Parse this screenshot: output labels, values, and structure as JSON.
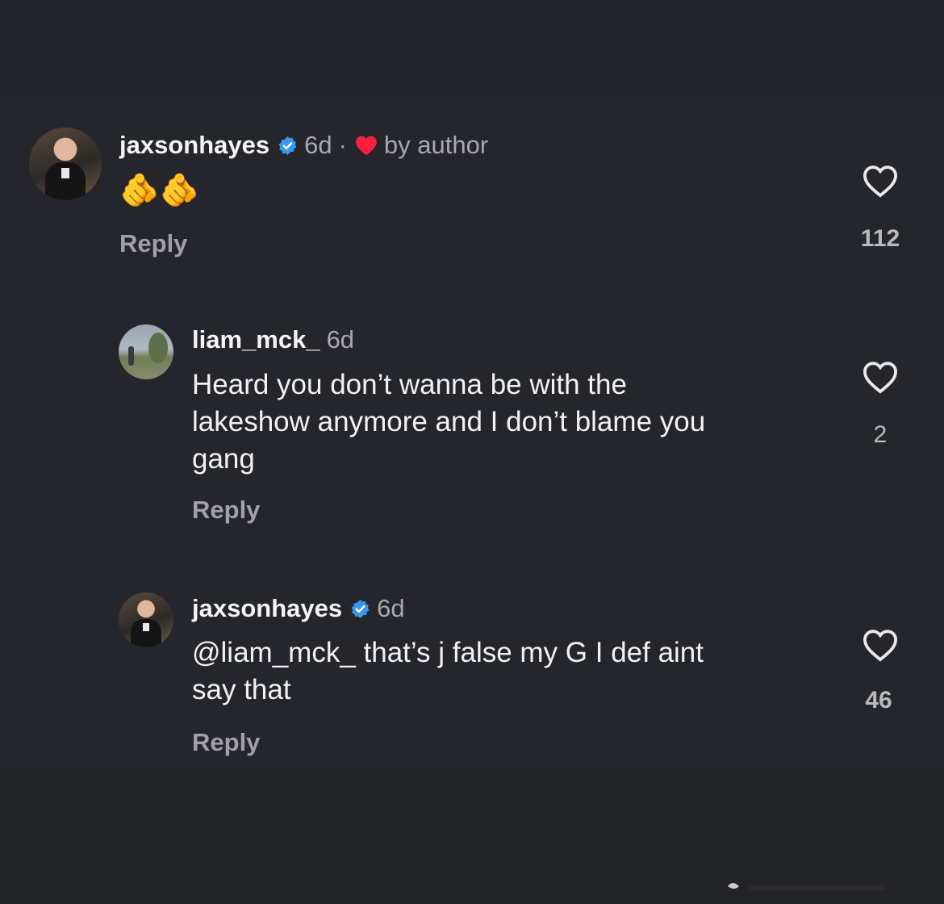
{
  "comments": [
    {
      "username": "jaxsonhayes",
      "verified": true,
      "time": "6d",
      "separator": "·",
      "author_badge": "by author",
      "text": "🫵🫵",
      "reply_label": "Reply",
      "like_count": "112"
    },
    {
      "username": "liam_mck_",
      "verified": false,
      "time": "6d",
      "text_lines": [
        "Heard you don’t wanna be with the",
        "lakeshow anymore and I don’t blame you",
        "gang"
      ],
      "reply_label": "Reply",
      "like_count": "2"
    },
    {
      "username": "jaxsonhayes",
      "verified": true,
      "time": "6d",
      "text_lines": [
        "@liam_mck_  that’s j false my G I def aint",
        "say that"
      ],
      "reply_label": "Reply",
      "like_count": "46"
    }
  ],
  "colors": {
    "background": "#25262c",
    "verified_blue": "#3897f0",
    "author_heart": "#ff1f3d",
    "muted_text": "#a8a9ae"
  },
  "icons": [
    "verified-badge-icon",
    "heart-filled-icon",
    "heart-outline-icon"
  ]
}
